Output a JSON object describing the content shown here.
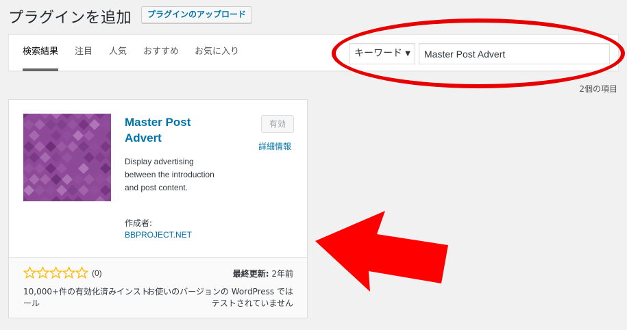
{
  "header": {
    "title": "プラグインを追加",
    "upload_label": "プラグインのアップロード"
  },
  "tabs": [
    {
      "label": "検索結果",
      "current": true
    },
    {
      "label": "注目"
    },
    {
      "label": "人気"
    },
    {
      "label": "おすすめ"
    },
    {
      "label": "お気に入り"
    }
  ],
  "search": {
    "type_selected": "キーワード",
    "value": "Master Post Advert"
  },
  "results": {
    "count_label": "2個の項目"
  },
  "plugin": {
    "name": "Master Post Advert",
    "activate_label": "有効",
    "details_label": "詳細情報",
    "description": "Display advertising between the introduction and post content.",
    "author_label": "作成者:",
    "author_name": "BBPROJECT.NET",
    "rating_stars_filled": 0,
    "rating_count": "(0)",
    "last_updated_label": "最終更新:",
    "last_updated_value": " 2年前",
    "installs": "10,000+件の有効化済みインストール",
    "compat": "お使いのバージョンの WordPress ではテストされていません"
  },
  "colors": {
    "link": "#0073aa",
    "annotation_red": "#e80000",
    "star": "#ffb900",
    "icon_base": "#8e4a98"
  },
  "icons": {
    "star": "star-empty-icon",
    "select_arrow": "caret-down-icon"
  }
}
